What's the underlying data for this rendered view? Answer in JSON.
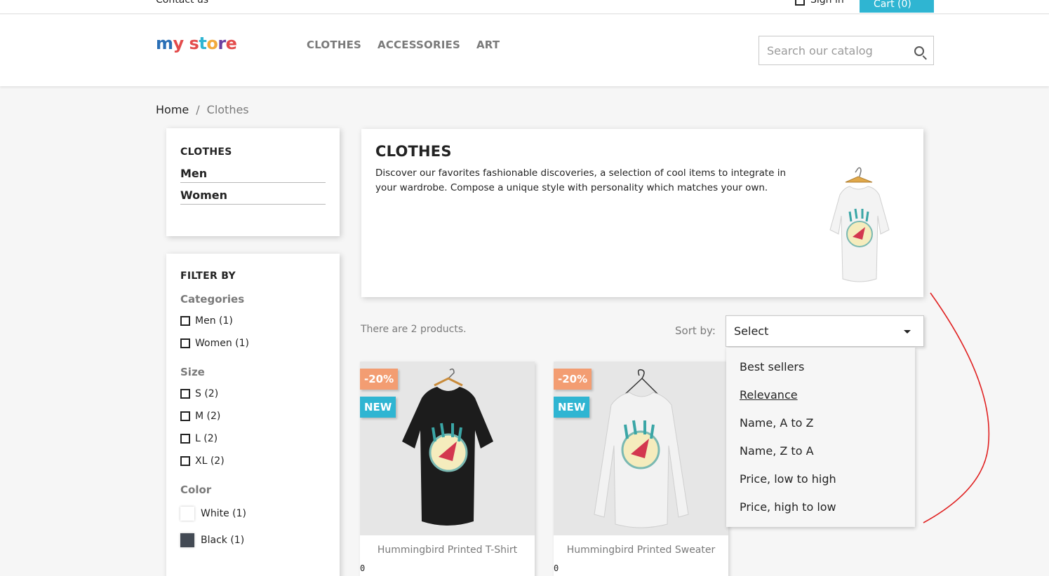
{
  "topbar": {
    "contact": "Contact us",
    "signin": "Sign in",
    "cart": "Cart (0)"
  },
  "header": {
    "logo": {
      "m": "m",
      "y": "y",
      "s": "s",
      "t": "t",
      "o": "o",
      "r": "r",
      "e": "e"
    },
    "nav": [
      "CLOTHES",
      "ACCESSORIES",
      "ART"
    ],
    "search_placeholder": "Search our catalog"
  },
  "breadcrumb": {
    "home": "Home",
    "sep": "/",
    "current": "Clothes"
  },
  "sidebar": {
    "categories_title": "CLOTHES",
    "categories": [
      "Men",
      "Women"
    ],
    "filter_title": "FILTER BY",
    "facets": {
      "categories": {
        "title": "Categories",
        "items": [
          "Men (1)",
          "Women (1)"
        ]
      },
      "size": {
        "title": "Size",
        "items": [
          "S (2)",
          "M (2)",
          "L (2)",
          "XL (2)"
        ]
      },
      "color": {
        "title": "Color",
        "items": [
          {
            "label": "White (1)",
            "swatch": "#ffffff"
          },
          {
            "label": "Black (1)",
            "swatch": "#434a54"
          }
        ]
      }
    }
  },
  "category": {
    "title": "CLOTHES",
    "description": "Discover our favorites fashionable discoveries, a selection of cool items to integrate in your wardrobe. Compose a unique style with personality which matches your own."
  },
  "listing": {
    "count": "There are 2 products.",
    "sort_label": "Sort by:",
    "sort_value": "Select",
    "sort_options": [
      "Best sellers",
      "Relevance",
      "Name, A to Z",
      "Name, Z to A",
      "Price, low to high",
      "Price, high to low"
    ],
    "current_option": "Relevance"
  },
  "products": [
    {
      "name": "Hummingbird Printed T-Shirt",
      "discount": "-20%",
      "flag": "NEW",
      "price": "0",
      "shirt_color": "#1c1c1c"
    },
    {
      "name": "Hummingbird Printed Sweater",
      "discount": "-20%",
      "flag": "NEW",
      "price": "0",
      "shirt_color": "#f2f2f2"
    }
  ],
  "colors": {
    "accent": "#2fb5d2",
    "discount": "#f39d72",
    "annotation": "#e02020"
  }
}
